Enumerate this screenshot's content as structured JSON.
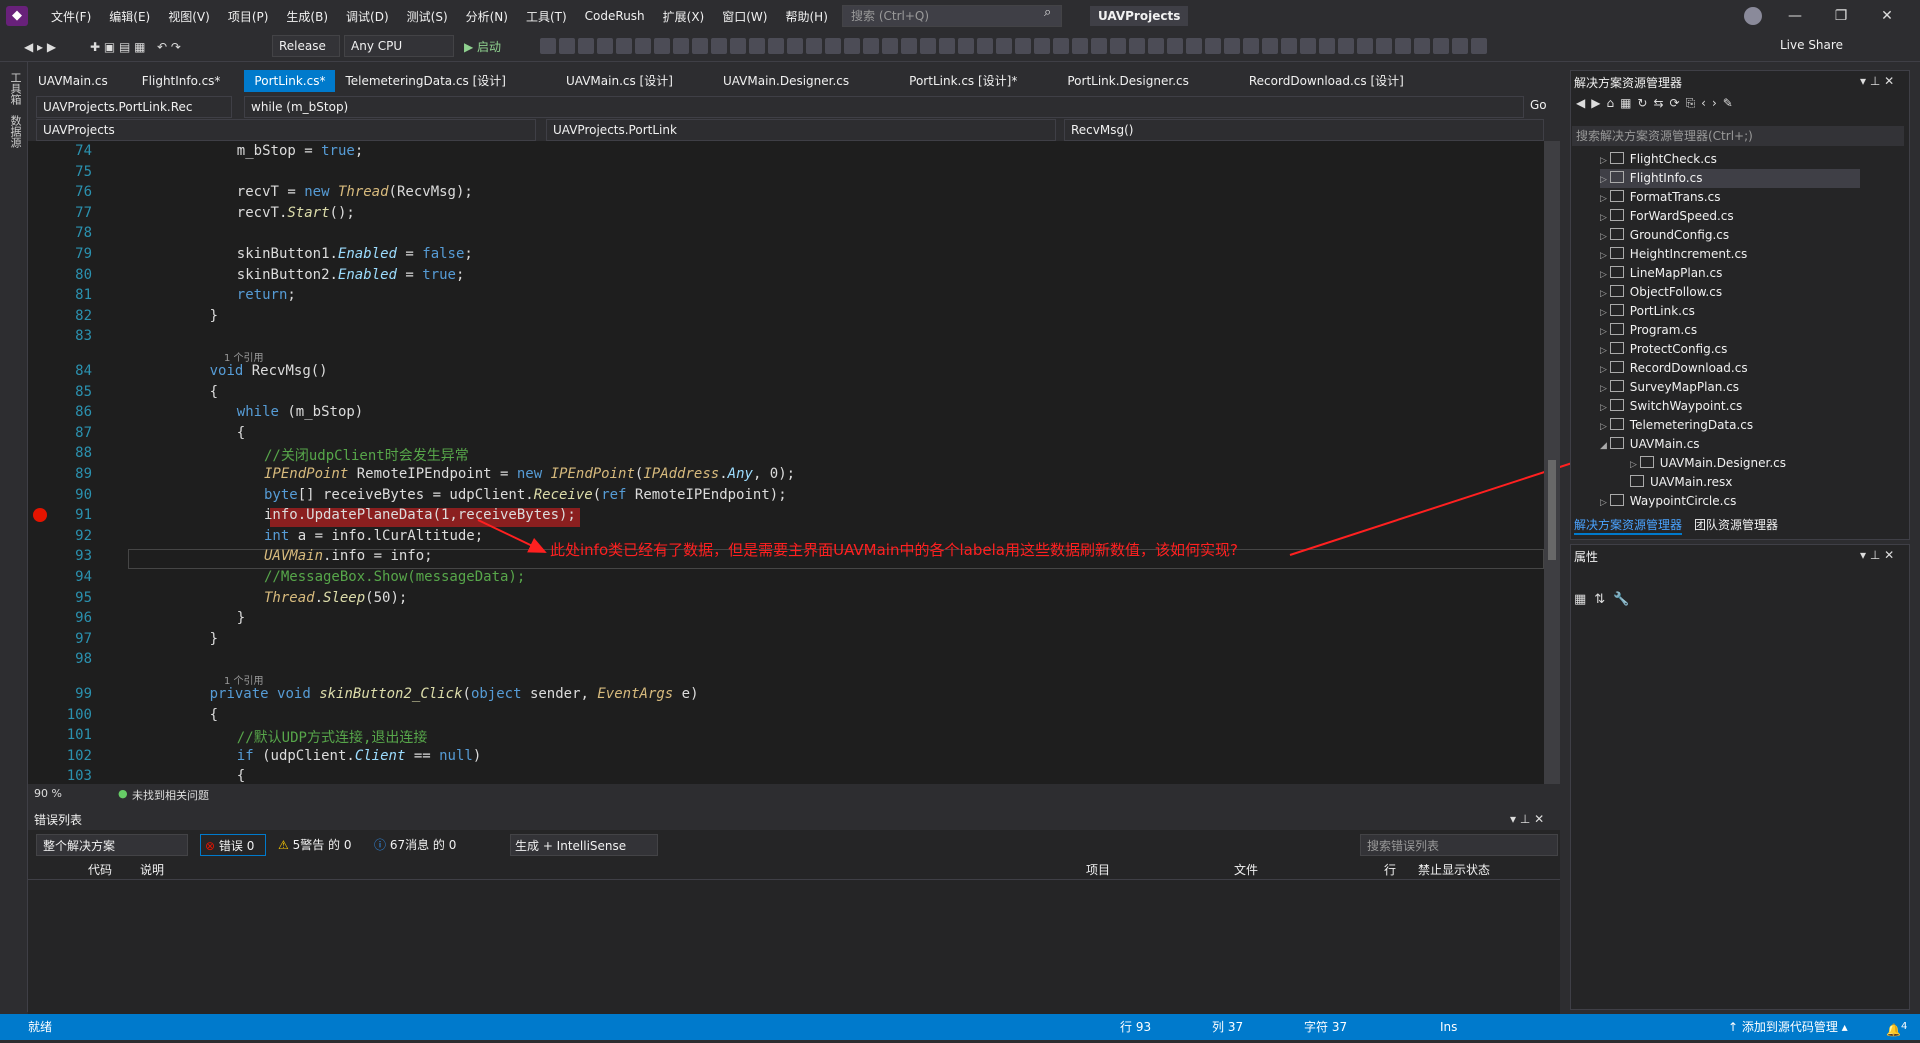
{
  "menu": {
    "items": [
      "文件(F)",
      "编辑(E)",
      "视图(V)",
      "项目(P)",
      "生成(B)",
      "调试(D)",
      "测试(S)",
      "分析(N)",
      "工具(T)",
      "CodeRush",
      "扩展(X)",
      "窗口(W)",
      "帮助(H)"
    ],
    "search_placeholder": "搜索 (Ctrl+Q)",
    "project_name": "UAVProjects"
  },
  "toolbar": {
    "config": "Release",
    "platform": "Any CPU",
    "start": "▶ 启动",
    "live_share": "Live Share"
  },
  "left_sidebar": {
    "items": [
      "工具箱",
      "数据源"
    ]
  },
  "tabs": [
    "UAVMain.cs",
    "FlightInfo.cs*",
    "PortLink.cs*",
    "TelemeteringData.cs [设计]",
    "UAVMain.cs [设计]",
    "UAVMain.Designer.cs",
    "PortLink.cs [设计]*",
    "PortLink.Designer.cs",
    "RecordDownload.cs [设计]"
  ],
  "navbar": {
    "project": "UAVProjects.PortLink.Rec",
    "scope": "while (m_bStop)",
    "go": "Go",
    "project2": "UAVProjects",
    "class": "UAVProjects.PortLink",
    "method": "RecvMsg()"
  },
  "code_lines": [
    {
      "n": "74",
      "html": "<span class='pr'></span>m_bStop = <span class='kw'>true</span>;",
      "indent": "                "
    },
    {
      "n": "75",
      "html": "",
      "indent": ""
    },
    {
      "n": "76",
      "html": "recvT = <span class='kw'>new</span> <span class='yl'>Thread</span>(RecvMsg);",
      "indent": "                "
    },
    {
      "n": "77",
      "html": "recvT.<span class='mt'>Start</span>();",
      "indent": "                "
    },
    {
      "n": "78",
      "html": "",
      "indent": ""
    },
    {
      "n": "79",
      "html": "skinButton1.<span class='pr'>Enabled</span> = <span class='kw'>false</span>;",
      "indent": "                "
    },
    {
      "n": "80",
      "html": "skinButton2.<span class='pr'>Enabled</span> = <span class='kw'>true</span>;",
      "indent": "                "
    },
    {
      "n": "81",
      "html": "<span class='kw'>return</span>;",
      "indent": "                "
    },
    {
      "n": "82",
      "html": "}",
      "indent": "            "
    },
    {
      "n": "83",
      "html": "",
      "indent": ""
    },
    {
      "n": "84",
      "html": "<span class='kw'>void</span> RecvMsg()",
      "indent": "            "
    },
    {
      "n": "85",
      "html": "{",
      "indent": "            "
    },
    {
      "n": "86",
      "html": "<span class='kw'>while</span> (m_bStop)",
      "indent": "                "
    },
    {
      "n": "87",
      "html": "{",
      "indent": "                "
    },
    {
      "n": "88",
      "html": "<span class='cm'>//关闭udpClient时会发生异常</span>",
      "indent": "                    "
    },
    {
      "n": "89",
      "html": "<span class='yl'>IPEndPoint</span> RemoteIPEndpoint = <span class='kw'>new</span> <span class='yl'>IPEndPoint</span>(<span class='yl'>IPAddress</span>.<span class='pr'>Any</span>, 0);",
      "indent": "                    "
    },
    {
      "n": "90",
      "html": "<span class='kw'>byte</span>[] receiveBytes = udpClient.<span class='mt'>Receive</span>(<span class='kw'>ref</span> RemoteIPEndpoint);",
      "indent": "                    "
    },
    {
      "n": "91",
      "html": "info.UpdatePlaneData(1,receiveBytes);",
      "indent": "                    "
    },
    {
      "n": "92",
      "html": "<span class='kw'>int</span> a = info.lCurAltitude;",
      "indent": "                    "
    },
    {
      "n": "93",
      "html": "<span class='yl'>UAVMain</span>.info = info;",
      "indent": "                    "
    },
    {
      "n": "94",
      "html": "<span class='cm'>//MessageBox.Show(messageData);</span>",
      "indent": "                    "
    },
    {
      "n": "95",
      "html": "<span class='yl'>Thread</span>.<span class='mt'>Sleep</span>(50);",
      "indent": "                    "
    },
    {
      "n": "96",
      "html": "}",
      "indent": "                "
    },
    {
      "n": "97",
      "html": "}",
      "indent": "            "
    },
    {
      "n": "98",
      "html": "",
      "indent": ""
    },
    {
      "n": "99",
      "html": "<span class='kw'>private</span> <span class='kw'>void</span> <span class='mt'>skinButton2_Click</span>(<span class='kw'>object</span> sender, <span class='yl'>EventArgs</span> e)",
      "indent": "            "
    },
    {
      "n": "100",
      "html": "{",
      "indent": "            "
    },
    {
      "n": "101",
      "html": "<span class='cm'>//默认UDP方式连接,退出连接</span>",
      "indent": "                "
    },
    {
      "n": "102",
      "html": "<span class='kw'>if</span> (udpClient.<span class='pr'>Client</span> == <span class='kw'>null</span>)",
      "indent": "                "
    },
    {
      "n": "103",
      "html": "{",
      "indent": "                "
    }
  ],
  "codelens": [
    "1 个引用",
    "1 个引用"
  ],
  "annotation": "此处info类已经有了数据，但是需要主界面UAVMain中的各个labela用这些数据刷新数值，该如何实现?",
  "editor_status": {
    "zoom": "90 %",
    "issues": "未找到相关问题"
  },
  "error_list": {
    "title": "错误列表",
    "scope": "整个解决方案",
    "errors": "错误 0",
    "warnings": "5警告 的 0",
    "messages": "67消息 的 0",
    "build": "生成 + IntelliSense",
    "search_placeholder": "搜索错误列表",
    "columns": [
      "代码",
      "说明",
      "项目",
      "文件",
      "行",
      "禁止显示状态"
    ]
  },
  "solution_explorer": {
    "title": "解决方案资源管理器",
    "search": "搜索解决方案资源管理器(Ctrl+;)",
    "items": [
      "FlightCheck.cs",
      "FlightInfo.cs",
      "FormatTrans.cs",
      "ForWardSpeed.cs",
      "GroundConfig.cs",
      "HeightIncrement.cs",
      "LineMapPlan.cs",
      "ObjectFollow.cs",
      "PortLink.cs",
      "Program.cs",
      "ProtectConfig.cs",
      "RecordDownload.cs",
      "SurveyMapPlan.cs",
      "SwitchWaypoint.cs",
      "TelemeteringData.cs",
      "UAVMain.cs",
      "UAVMain.Designer.cs",
      "UAVMain.resx",
      "WaypointCircle.cs"
    ],
    "tab1": "解决方案资源管理器",
    "tab2": "团队资源管理器"
  },
  "properties": {
    "title": "属性"
  },
  "statusbar": {
    "ready": "就绪",
    "line": "行 93",
    "col": "列 37",
    "char": "字符 37",
    "ins": "Ins",
    "source": "↑ 添加到源代码管理 ▴",
    "notif": "4"
  }
}
